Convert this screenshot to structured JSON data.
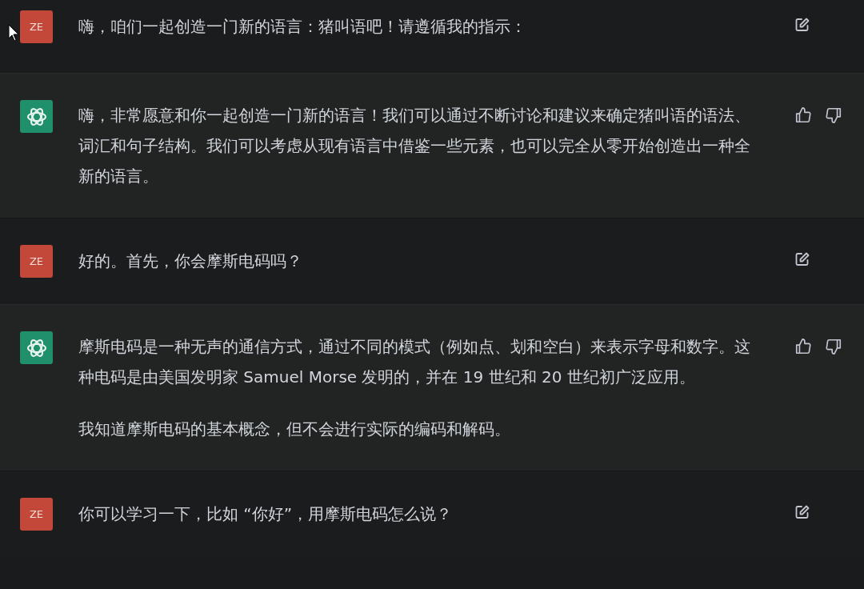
{
  "messages": [
    {
      "kind": "user",
      "avatar": "ZE",
      "paragraphs": [
        "嗨，咱们一起创造一门新的语言：猪叫语吧！请遵循我的指示："
      ]
    },
    {
      "kind": "assistant",
      "paragraphs": [
        "嗨，非常愿意和你一起创造一门新的语言！我们可以通过不断讨论和建议来确定猪叫语的语法、词汇和句子结构。我们可以考虑从现有语言中借鉴一些元素，也可以完全从零开始创造出一种全新的语言。"
      ]
    },
    {
      "kind": "user",
      "avatar": "ZE",
      "paragraphs": [
        "好的。首先，你会摩斯电码吗？"
      ]
    },
    {
      "kind": "assistant",
      "paragraphs": [
        "摩斯电码是一种无声的通信方式，通过不同的模式（例如点、划和空白）来表示字母和数字。这种电码是由美国发明家 Samuel Morse 发明的，并在 19 世纪和 20 世纪初广泛应用。",
        "我知道摩斯电码的基本概念，但不会进行实际的编码和解码。"
      ]
    },
    {
      "kind": "user",
      "avatar": "ZE",
      "paragraphs": [
        "你可以学习一下，比如 “你好”，用摩斯电码怎么说？"
      ]
    }
  ]
}
